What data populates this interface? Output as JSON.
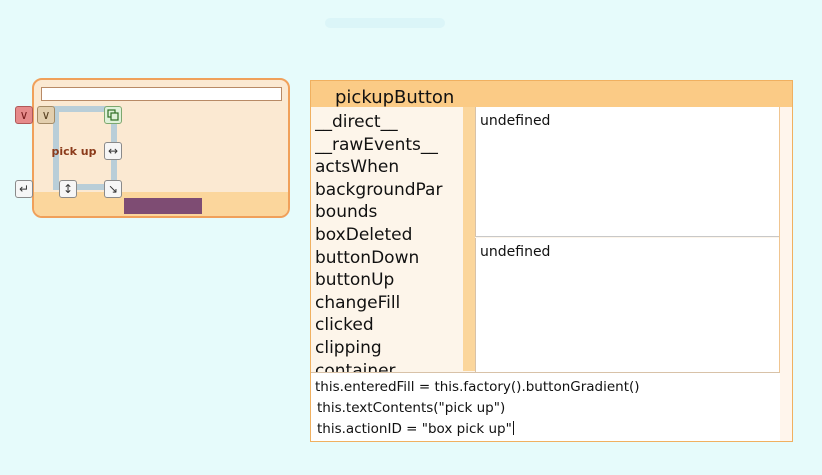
{
  "halo": {
    "morph_label": "pick up",
    "buttons": [
      {
        "icon": "chevron-down-icon",
        "role": "menu"
      },
      {
        "icon": "chevron-down-icon",
        "role": "menu2"
      },
      {
        "icon": "duplicate-icon",
        "role": "copy"
      },
      {
        "icon": "resize-horizontal-icon",
        "role": "resize-width"
      },
      {
        "icon": "rotate-icon",
        "role": "rotate"
      },
      {
        "icon": "resize-vertical-icon",
        "role": "resize-height"
      },
      {
        "icon": "resize-diagonal-icon",
        "role": "resize"
      }
    ]
  },
  "inspector": {
    "title": "pickupButton",
    "properties": [
      "__direct__",
      "__rawEvents__",
      "actsWhen",
      "backgroundPar",
      "bounds",
      "boxDeleted",
      "buttonDown",
      "buttonUp",
      "changeFill",
      "clicked",
      "clipping",
      "container"
    ],
    "value_top": "undefined",
    "value_bottom": "undefined",
    "code_lines": [
      "this.enteredFill = this.factory().buttonGradient()",
      "this.textContents(\"pick up\")",
      "this.actionID = \"box pick up\""
    ]
  },
  "colors": {
    "background": "#e6fbfb",
    "panel_border": "#f0a05a",
    "header": "#fbcb86",
    "accent_purple": "#7e4c73"
  }
}
